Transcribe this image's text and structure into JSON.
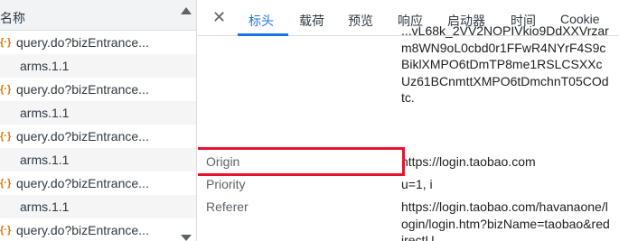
{
  "list": {
    "header": "名称",
    "rows": [
      {
        "icon": "{·}",
        "name": "query.do?bizEntrance..."
      },
      {
        "icon": "",
        "name": "arms.1.1"
      },
      {
        "icon": "{·}",
        "name": "query.do?bizEntrance..."
      },
      {
        "icon": "",
        "name": "arms.1.1"
      },
      {
        "icon": "{·}",
        "name": "query.do?bizEntrance..."
      },
      {
        "icon": "",
        "name": "arms.1.1"
      },
      {
        "icon": "{·}",
        "name": "query.do?bizEntrance..."
      },
      {
        "icon": "",
        "name": "arms.1.1"
      },
      {
        "icon": "{·}",
        "name": "query.do?bizEntrance..."
      }
    ]
  },
  "tabs": [
    "标头",
    "载荷",
    "预览",
    "响应",
    "启动器",
    "时间",
    "Cookie"
  ],
  "headers": {
    "previous_value_tail": "...vL68k_2VV2NOPIVkio9DdXXVrzarm8WN9oL0cbd0r1FFwR4NYrF4S9cBiklXMPO6tDmTP8me1RSLCSXXcUz61BCnmttXMPO6tDmchnT05COdtc.",
    "rows": [
      {
        "name": "Origin",
        "value": "https://login.taobao.com"
      },
      {
        "name": "Priority",
        "value": "u=1, i"
      },
      {
        "name": "Referer",
        "value": "https://login.taobao.com/havanaone/login/login.htm?bizName=taobao&redirectU"
      }
    ]
  }
}
